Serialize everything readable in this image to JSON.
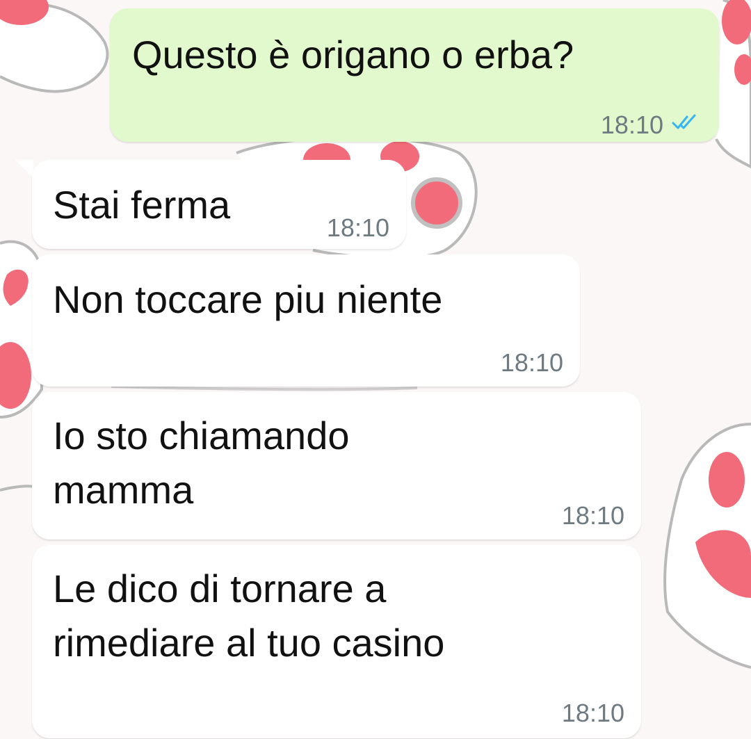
{
  "colors": {
    "outgoing_bubble": "#e2f8cd",
    "incoming_bubble": "#ffffff",
    "timestamp": "#6e7a82",
    "read_ticks": "#34b7f1",
    "wallpaper_accent": "#f26b7a"
  },
  "messages": [
    {
      "direction": "outgoing",
      "text": "Questo è origano o erba?",
      "time": "18:10",
      "status_icon": "double-check-read-icon"
    },
    {
      "direction": "incoming",
      "text": "Stai ferma",
      "time": "18:10"
    },
    {
      "direction": "incoming",
      "text": "Non toccare piu niente",
      "time": "18:10"
    },
    {
      "direction": "incoming",
      "text": "Io sto chiamando\nmamma",
      "time": "18:10"
    },
    {
      "direction": "incoming",
      "text": "Le dico di tornare a\nrimediare al tuo casino",
      "time": "18:10"
    }
  ]
}
